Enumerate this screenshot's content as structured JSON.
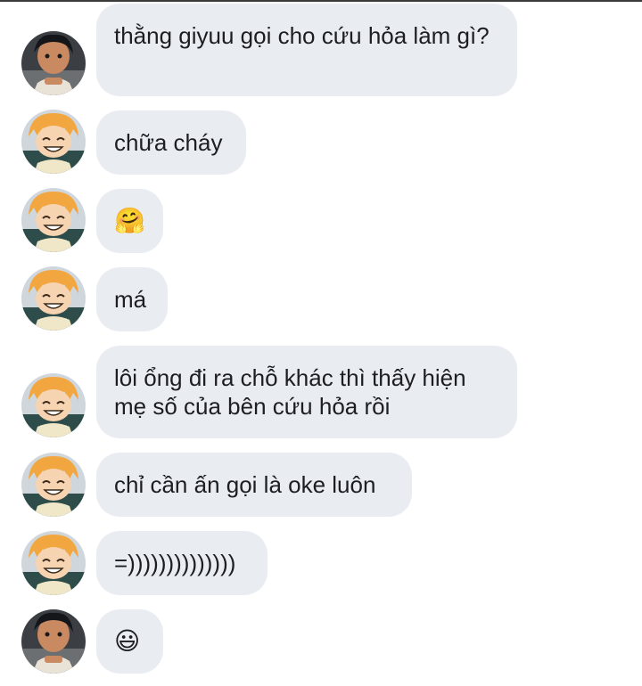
{
  "messages": [
    {
      "sender": "dark-hair-character",
      "text": "thằng giyuu gọi cho cứu hỏa làm gì?"
    },
    {
      "sender": "orange-hair-character",
      "text": "chữa cháy"
    },
    {
      "sender": "orange-hair-character",
      "text": "🤗"
    },
    {
      "sender": "orange-hair-character",
      "text": "má"
    },
    {
      "sender": "orange-hair-character",
      "text": "lôi ổng đi ra chỗ khác thì thấy hiện mẹ số của bên cứu hỏa rồi"
    },
    {
      "sender": "orange-hair-character",
      "text": "chỉ cần ấn gọi là oke luôn"
    },
    {
      "sender": "orange-hair-character",
      "text": "=))))))))))))))"
    },
    {
      "sender": "dark-hair-character",
      "text": "😃"
    }
  ],
  "colors": {
    "bubble": "#e9edf2",
    "text": "#1c1e21",
    "background": "#ffffff"
  }
}
